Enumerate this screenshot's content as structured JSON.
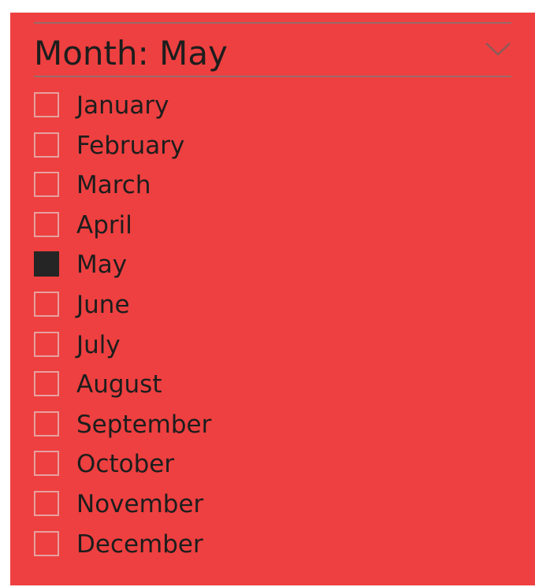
{
  "slicer": {
    "title": "Month: May",
    "items": [
      {
        "label": "January",
        "checked": false
      },
      {
        "label": "February",
        "checked": false
      },
      {
        "label": "March",
        "checked": false
      },
      {
        "label": "April",
        "checked": false
      },
      {
        "label": "May",
        "checked": true
      },
      {
        "label": "June",
        "checked": false
      },
      {
        "label": "July",
        "checked": false
      },
      {
        "label": "August",
        "checked": false
      },
      {
        "label": "September",
        "checked": false
      },
      {
        "label": "October",
        "checked": false
      },
      {
        "label": "November",
        "checked": false
      },
      {
        "label": "December",
        "checked": false
      }
    ]
  },
  "colors": {
    "panel_background": "#ee4040",
    "text": "#1d1d1d",
    "checkbox_border": "#e8a0a0",
    "checkbox_checked": "#252525",
    "rule": "#9a6a6a"
  },
  "icons": {
    "dropdown": "chevron-down-icon"
  }
}
